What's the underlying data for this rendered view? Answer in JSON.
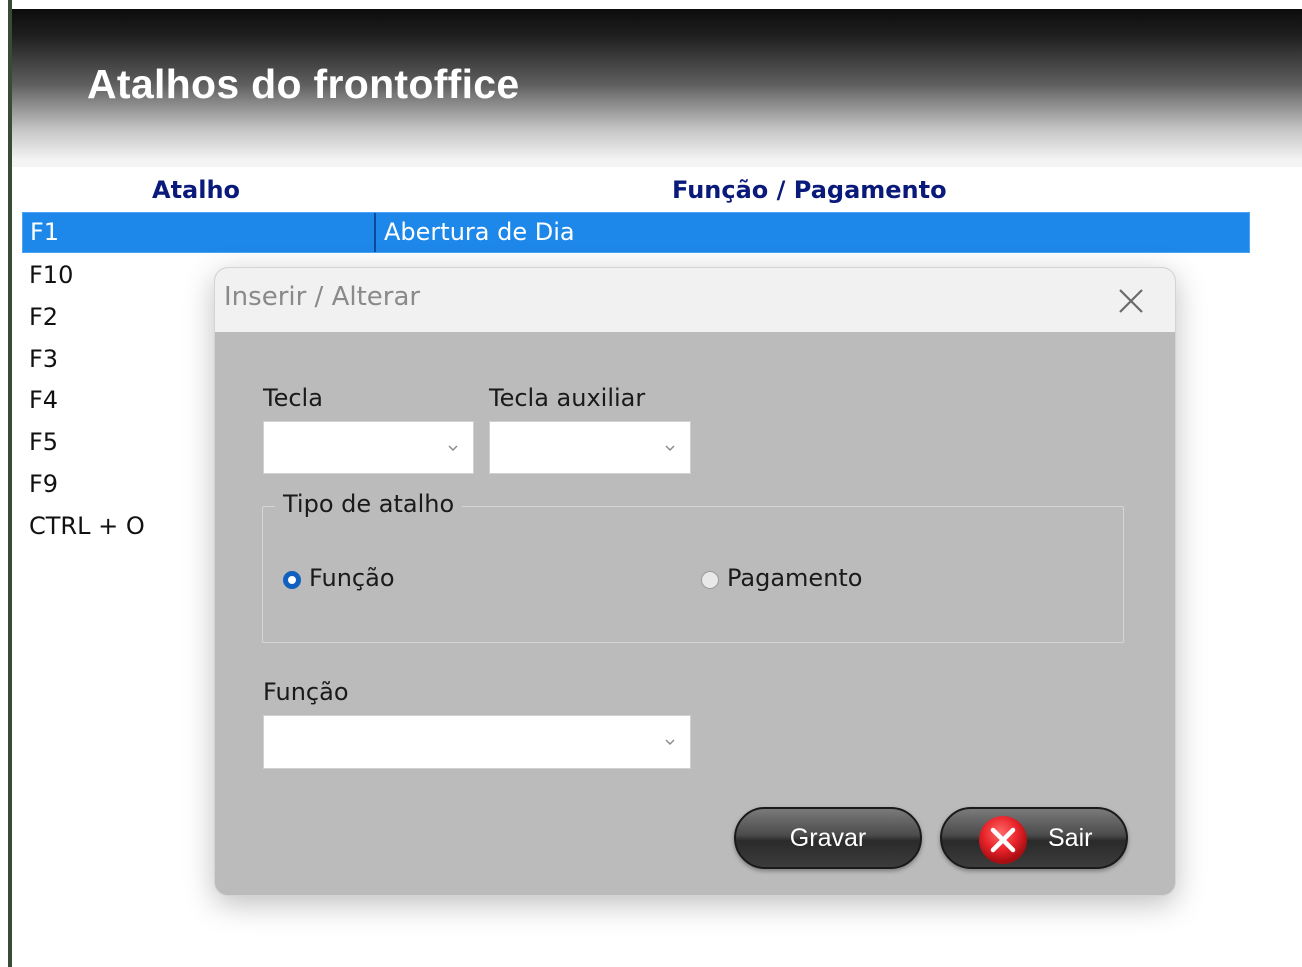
{
  "header": {
    "title": "Atalhos do frontoffice"
  },
  "table": {
    "columns": [
      "Atalho",
      "Função / Pagamento"
    ],
    "rows": [
      {
        "key": "F1",
        "value": "Abertura de Dia",
        "selected": true
      },
      {
        "key": "F10",
        "value": ""
      },
      {
        "key": "F2",
        "value": ""
      },
      {
        "key": "F3",
        "value": ""
      },
      {
        "key": "F4",
        "value": ""
      },
      {
        "key": "F5",
        "value": ""
      },
      {
        "key": "F9",
        "value": ""
      },
      {
        "key": "CTRL + O",
        "value": ""
      }
    ]
  },
  "dialog": {
    "title": "Inserir / Alterar",
    "close_icon": "close-icon",
    "tecla": {
      "label": "Tecla",
      "value": ""
    },
    "tecla_auxiliar": {
      "label": "Tecla auxiliar",
      "value": ""
    },
    "tipo_atalho": {
      "legend": "Tipo de atalho",
      "options": [
        {
          "label": "Função",
          "checked": true
        },
        {
          "label": "Pagamento",
          "checked": false
        }
      ]
    },
    "funcao": {
      "label": "Função",
      "value": ""
    },
    "buttons": {
      "save_label": "Gravar",
      "exit_label": "Sair",
      "exit_icon": "x-circle-icon"
    }
  },
  "colors": {
    "selection": "#1e88ea",
    "header_text": "#0a1a7a",
    "dialog_bg": "#bbbbbb",
    "radio_on": "#1060c0",
    "exit_icon": "#e8232a"
  }
}
